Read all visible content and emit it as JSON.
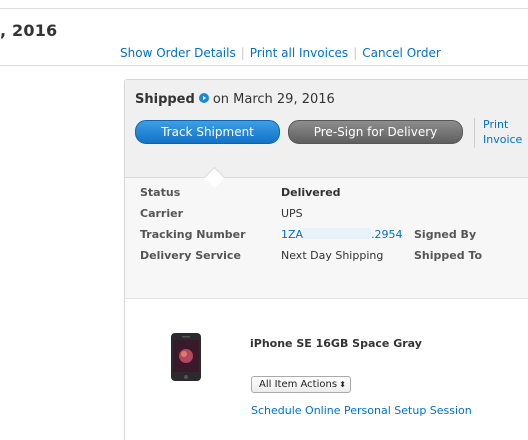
{
  "order": {
    "date_fragment": ", 2016",
    "links": [
      "Show Order Details",
      "Print all Invoices",
      "Cancel Order"
    ]
  },
  "shipment": {
    "status": "Shipped",
    "date_text": "on March 29, 2016",
    "buttons": {
      "track": "Track Shipment",
      "presign": "Pre-Sign for Delivery"
    },
    "print_invoice": [
      "Print",
      "Invoice"
    ],
    "details": {
      "status_label": "Status",
      "status_value": "Delivered",
      "carrier_label": "Carrier",
      "carrier_value": "UPS",
      "tracking_label": "Tracking Number",
      "tracking_prefix": "1ZA",
      "tracking_suffix": ".2954",
      "delivery_service_label": "Delivery Service",
      "delivery_service_value": "Next Day Shipping",
      "signed_by_label": "Signed By",
      "shipped_to_label": "Shipped To"
    }
  },
  "item": {
    "name": "iPhone SE 16GB Space Gray",
    "actions_select": "All Item Actions",
    "setup_link": "Schedule Online Personal Setup Session"
  },
  "colors": {
    "link": "#0070c9",
    "track_button": "#1b7fd3",
    "presign_button": "#6e6e6e",
    "header_bg": "#f0f0f0",
    "details_bg": "#f7f7f7"
  },
  "icons": {
    "status_info": "info-arrow-icon",
    "select_arrow": "updown-arrows-icon",
    "product": "iphone-se-image"
  }
}
